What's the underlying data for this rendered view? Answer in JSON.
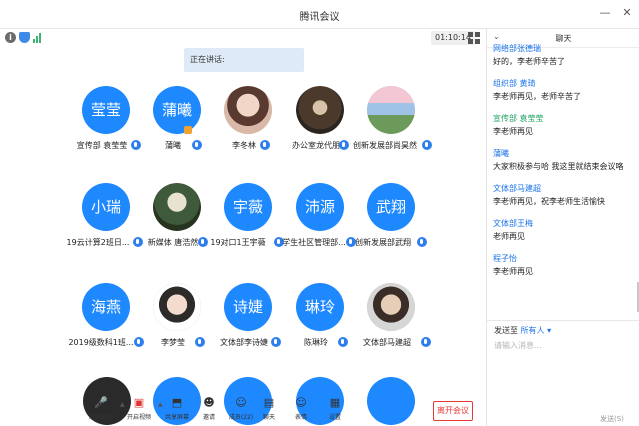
{
  "window": {
    "title": "腾讯会议",
    "minimize": "—",
    "close": "✕"
  },
  "status": {
    "timer": "01:10:14"
  },
  "speaking": {
    "label": "正在讲话:"
  },
  "participants": [
    {
      "avatar_text": "莹莹",
      "name": "宣传部 袁莹莹"
    },
    {
      "avatar_text": "蒲曦",
      "name": "蒲曦"
    },
    {
      "avatar_text": "",
      "name": "李冬林"
    },
    {
      "avatar_text": "",
      "name": "办公室龙代朋"
    },
    {
      "avatar_text": "",
      "name": "创新发展部尚昊然"
    },
    {
      "avatar_text": "小瑞",
      "name": "19云计算2班日..."
    },
    {
      "avatar_text": "",
      "name": "新媒体 唐浩然"
    },
    {
      "avatar_text": "宇薇",
      "name": "19对口1王宇薇"
    },
    {
      "avatar_text": "沛源",
      "name": "学生社区管理部..."
    },
    {
      "avatar_text": "武翔",
      "name": "创新发展部武翔"
    },
    {
      "avatar_text": "海燕",
      "name": "2019级数科1班..."
    },
    {
      "avatar_text": "",
      "name": "李梦莹"
    },
    {
      "avatar_text": "诗婕",
      "name": "文体部李诗婕"
    },
    {
      "avatar_text": "琳玲",
      "name": "陈琳玲"
    },
    {
      "avatar_text": "",
      "name": "文体部马建超"
    }
  ],
  "toolbar": {
    "mute": "解除静音",
    "video": "开启视频",
    "share": "共享屏幕",
    "invite": "邀请",
    "members": "成员(22)",
    "chat": "聊天",
    "reactions": "表情",
    "settings": "设置",
    "leave": "离开会议"
  },
  "chat": {
    "title": "聊天",
    "messages": [
      {
        "sender": "网络部张德瑞",
        "text": "好的，李老师辛苦了",
        "color": "#1a73e8"
      },
      {
        "sender": "组织部 黄琦",
        "text": "李老师再见，老师辛苦了",
        "color": "#1a73e8"
      },
      {
        "sender": "宣传部 袁莹莹",
        "text": "李老师再见",
        "color": "#20a264"
      },
      {
        "sender": "蒲曦",
        "text": "大家积极参与哈 我这里就结束会议咯",
        "color": "#1a73e8"
      },
      {
        "sender": "文体部马建超",
        "text": "李老师再见，祝李老师生活愉快",
        "color": "#1a73e8"
      },
      {
        "sender": "文体部王梅",
        "text": "老师再见",
        "color": "#1a73e8"
      },
      {
        "sender": "程子怡",
        "text": "李老师再见",
        "color": "#1a73e8"
      }
    ],
    "send_to_prefix": "发送至",
    "send_to_target": "所有人",
    "input_placeholder": "请输入消息...",
    "send_button": "发送(S)"
  }
}
